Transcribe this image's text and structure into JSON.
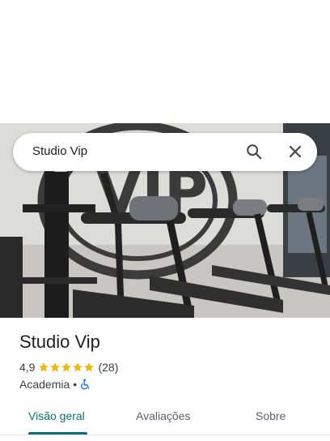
{
  "search": {
    "query": "Studio Vip"
  },
  "place": {
    "name": "Studio Vip",
    "rating": "4,9",
    "reviews": "(28)",
    "category": "Academia",
    "separator": "•",
    "star_color": "#f4b400"
  },
  "tabs": [
    {
      "label": "Visão geral",
      "active": true
    },
    {
      "label": "Avaliações",
      "active": false
    },
    {
      "label": "Sobre",
      "active": false
    }
  ],
  "colors": {
    "accent": "#0a6f78",
    "text": "#202124",
    "muted": "#5f6368"
  },
  "icons": {
    "search": "search-icon",
    "close": "close-icon",
    "accessibility": "wheelchair-icon",
    "star": "star-icon"
  }
}
